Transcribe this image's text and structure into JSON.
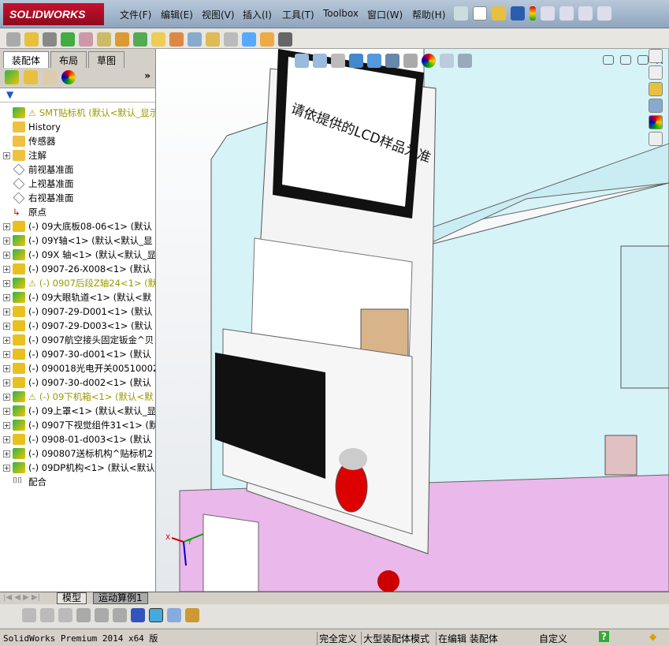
{
  "title_bar": {
    "logo": "SOLIDWORKS",
    "menus": [
      "文件(F)",
      "编辑(E)",
      "视图(V)",
      "插入(I)",
      "工具(T)",
      "Toolbox",
      "窗口(W)",
      "帮助(H)"
    ]
  },
  "panel": {
    "tabs": [
      "装配体",
      "布局",
      "草图"
    ],
    "expand_label": "»"
  },
  "tree": [
    {
      "label": "SMT贴标机  (默认<默认_显示",
      "warn": true,
      "type": "top"
    },
    {
      "label": "History",
      "type": "history"
    },
    {
      "label": "传感器",
      "type": "sensor"
    },
    {
      "label": "注解",
      "type": "annot",
      "pm": true
    },
    {
      "label": "前视基准面",
      "type": "plane"
    },
    {
      "label": "上视基准面",
      "type": "plane"
    },
    {
      "label": "右视基准面",
      "type": "plane"
    },
    {
      "label": "原点",
      "type": "origin"
    },
    {
      "label": "(-) 09大底板08-06<1> (默认",
      "type": "part",
      "pm": true
    },
    {
      "label": "(-) 09Y轴<1> (默认<默认_显",
      "type": "asm",
      "pm": true
    },
    {
      "label": "(-) 09X 轴<1> (默认<默认_显",
      "type": "asm",
      "pm": true
    },
    {
      "label": "(-) 0907-26-X008<1> (默认",
      "type": "part",
      "pm": true
    },
    {
      "label": "(-) 0907后段Z轴24<1> (默",
      "type": "asm",
      "pm": true,
      "warn": true
    },
    {
      "label": "(-) 09大眼轨道<1> (默认<默",
      "type": "asm",
      "pm": true
    },
    {
      "label": "(-) 0907-29-D001<1> (默认",
      "type": "part",
      "pm": true
    },
    {
      "label": "(-) 0907-29-D003<1> (默认",
      "type": "part",
      "pm": true
    },
    {
      "label": "(-) 0907航空接头固定钣金^贝",
      "type": "part",
      "pm": true
    },
    {
      "label": "(-) 0907-30-d001<1> (默认",
      "type": "part",
      "pm": true
    },
    {
      "label": "(-) 090018光电开关00510002",
      "type": "part",
      "pm": true
    },
    {
      "label": "(-) 0907-30-d002<1> (默认",
      "type": "part",
      "pm": true
    },
    {
      "label": "(-) 09下机箱<1> (默认<默",
      "type": "asm",
      "pm": true,
      "warn": true
    },
    {
      "label": "(-) 09上罩<1> (默认<默认_显",
      "type": "asm",
      "pm": true
    },
    {
      "label": "(-) 0907下视觉组件31<1> (默",
      "type": "asm",
      "pm": true
    },
    {
      "label": "(-) 0908-01-d003<1> (默认",
      "type": "part",
      "pm": true
    },
    {
      "label": "(-) 090807送标机构^贴标机2",
      "type": "asm",
      "pm": true
    },
    {
      "label": "(-) 09DP机构<1> (默认<默认",
      "type": "asm",
      "pm": true
    },
    {
      "label": "配合",
      "type": "mate"
    }
  ],
  "viewport": {
    "lcd_text": "请依提供的LCD样品为准",
    "triad": {
      "x": "X",
      "y": "Y"
    }
  },
  "bottom_tabs": [
    "模型",
    "运动算例1"
  ],
  "status": {
    "version": "SolidWorks Premium 2014 x64 版",
    "fully_defined": "完全定义",
    "large_mode": "大型装配体模式",
    "editing": "在编辑 装配体",
    "units": "自定义",
    "help": "?"
  },
  "colors": {
    "cyan": "#d6f3f7",
    "pink": "#eab8ea",
    "accent": "#c8102e"
  }
}
